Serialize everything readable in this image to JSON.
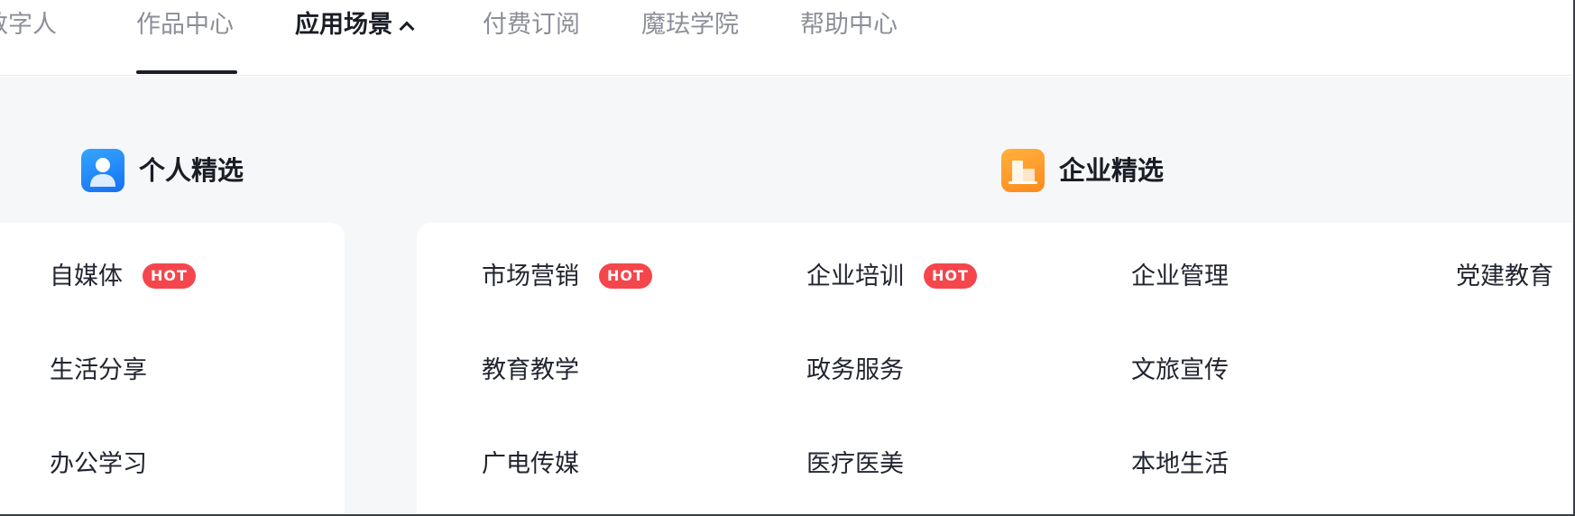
{
  "nav": {
    "items": [
      {
        "label": "数字人"
      },
      {
        "label": "作品中心"
      },
      {
        "label": "应用场景"
      },
      {
        "label": "付费订阅"
      },
      {
        "label": "魔珐学院"
      },
      {
        "label": "帮助中心"
      }
    ],
    "active_index": 2
  },
  "personal": {
    "title": "个人精选",
    "items": [
      {
        "label": "自媒体",
        "badge": "HOT"
      },
      {
        "label": "生活分享"
      },
      {
        "label": "办公学习"
      }
    ]
  },
  "enterprise": {
    "title": "企业精选",
    "items": [
      {
        "label": "市场营销",
        "badge": "HOT"
      },
      {
        "label": "企业培训",
        "badge": "HOT"
      },
      {
        "label": "企业管理"
      },
      {
        "label": "党建教育"
      },
      {
        "label": "教育教学"
      },
      {
        "label": "政务服务"
      },
      {
        "label": "文旅宣传"
      },
      {
        "label": "广电传媒"
      },
      {
        "label": "医疗医美"
      },
      {
        "label": "本地生活"
      }
    ]
  },
  "colors": {
    "hot_badge": "#f5464c",
    "person_icon": "#1470f2",
    "company_icon": "#ff8a1c",
    "panel_bg": "#f6f7f9"
  },
  "icons": {
    "person": "person-icon",
    "company": "building-icon",
    "chevron": "chevron-up-icon"
  }
}
